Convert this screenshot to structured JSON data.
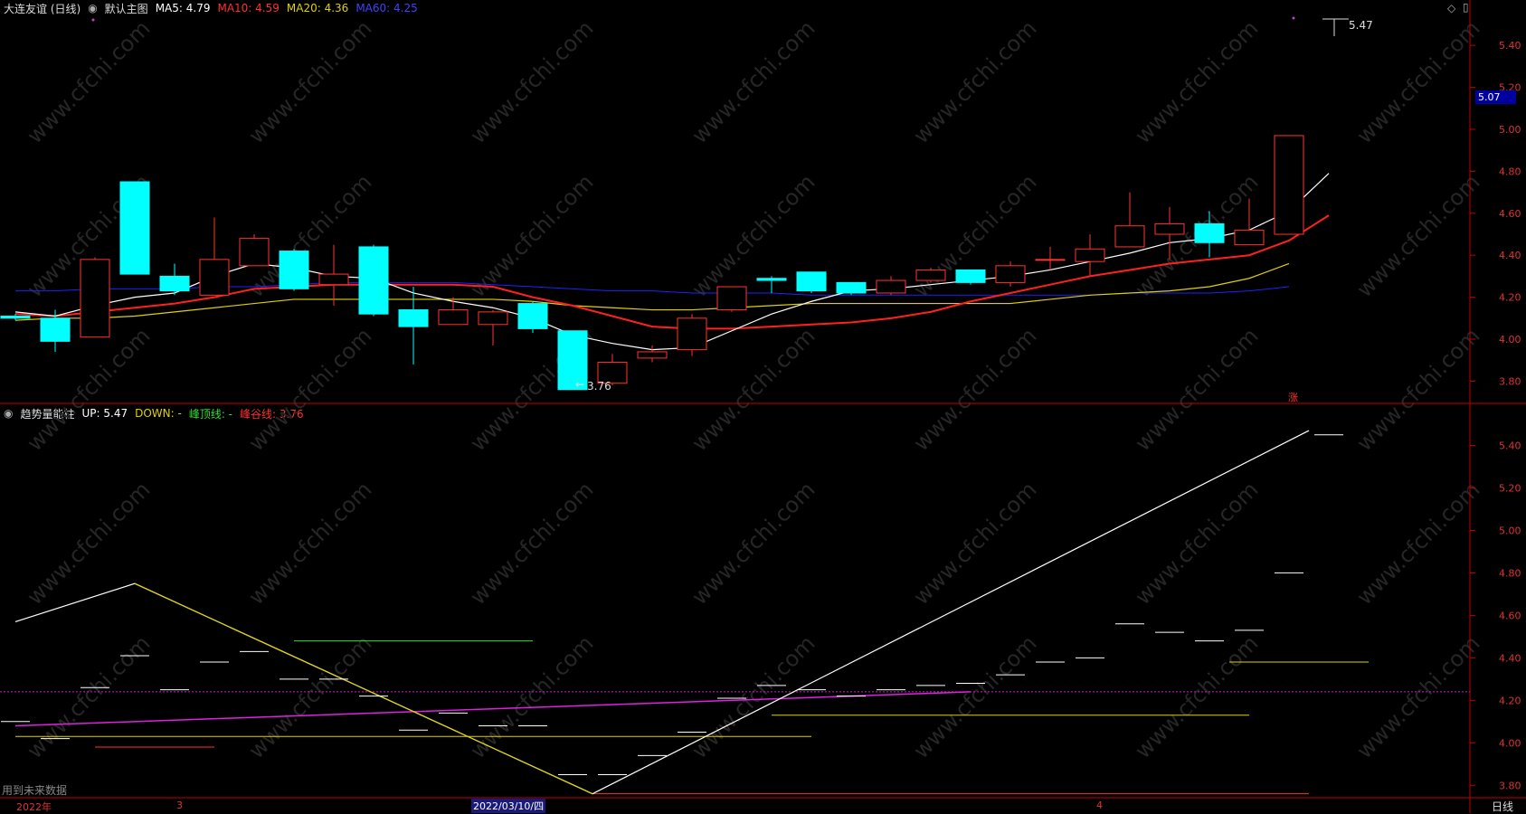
{
  "top_legend": {
    "stock_name": "大连友谊 (日线)",
    "main_chart": "默认主图",
    "ma5": "MA5: 4.79",
    "ma10": "MA10: 4.59",
    "ma20": "MA20: 4.36",
    "ma60": "MA60: 4.25"
  },
  "bottom_legend": {
    "indicator": "趋势量能柱",
    "up": "UP: 5.47",
    "down": "DOWN: -",
    "peak": "峰顶线: -",
    "valley": "峰谷线: 3.76"
  },
  "colors": {
    "up_candle": "#ff3232",
    "down_candle": "#00ffff",
    "ma5": "#ffffff",
    "ma10": "#ff2020",
    "ma20": "#e0d000",
    "ma60": "#2020ff",
    "axis": "#c00000"
  },
  "price_axis": [
    "5.40",
    "5.20",
    "5.00",
    "4.80",
    "4.60",
    "4.40",
    "4.20",
    "4.00",
    "3.80"
  ],
  "indicator_axis": [
    "5.40",
    "5.20",
    "5.00",
    "4.80",
    "4.60",
    "4.40",
    "4.20",
    "4.00",
    "3.80"
  ],
  "current_price_tag": "5.07",
  "high_marker": "5.47",
  "low_marker": "3.76",
  "rise_badge": "涨",
  "future_data_note": "用到未来数据",
  "x_labels": {
    "year": "2022年",
    "m3": "3",
    "cursor_date": "2022/03/10/四",
    "m4": "4"
  },
  "period_button": "日线",
  "watermark": "www.cfchi.com",
  "chart_data": {
    "type": "candlestick",
    "candles": [
      {
        "o": 4.11,
        "h": 4.12,
        "l": 4.09,
        "c": 4.1
      },
      {
        "o": 4.1,
        "h": 4.14,
        "l": 3.94,
        "c": 3.99
      },
      {
        "o": 4.01,
        "h": 4.39,
        "l": 4.01,
        "c": 4.38
      },
      {
        "o": 4.75,
        "h": 4.75,
        "l": 4.31,
        "c": 4.31
      },
      {
        "o": 4.3,
        "h": 4.36,
        "l": 4.21,
        "c": 4.23
      },
      {
        "o": 4.21,
        "h": 4.58,
        "l": 4.21,
        "c": 4.38
      },
      {
        "o": 4.35,
        "h": 4.5,
        "l": 4.35,
        "c": 4.48
      },
      {
        "o": 4.42,
        "h": 4.43,
        "l": 4.23,
        "c": 4.24
      },
      {
        "o": 4.26,
        "h": 4.45,
        "l": 4.16,
        "c": 4.31
      },
      {
        "o": 4.44,
        "h": 4.45,
        "l": 4.11,
        "c": 4.12
      },
      {
        "o": 4.14,
        "h": 4.25,
        "l": 3.88,
        "c": 4.06
      },
      {
        "o": 4.07,
        "h": 4.2,
        "l": 4.07,
        "c": 4.14
      },
      {
        "o": 4.07,
        "h": 4.14,
        "l": 3.97,
        "c": 4.13
      },
      {
        "o": 4.17,
        "h": 4.18,
        "l": 4.03,
        "c": 4.05
      },
      {
        "o": 4.04,
        "h": 4.04,
        "l": 3.76,
        "c": 3.76
      },
      {
        "o": 3.79,
        "h": 3.93,
        "l": 3.78,
        "c": 3.89
      },
      {
        "o": 3.91,
        "h": 3.97,
        "l": 3.89,
        "c": 3.94
      },
      {
        "o": 3.95,
        "h": 4.12,
        "l": 3.92,
        "c": 4.1
      },
      {
        "o": 4.14,
        "h": 4.25,
        "l": 4.13,
        "c": 4.25
      },
      {
        "o": 4.29,
        "h": 4.3,
        "l": 4.22,
        "c": 4.28
      },
      {
        "o": 4.32,
        "h": 4.32,
        "l": 4.22,
        "c": 4.23
      },
      {
        "o": 4.27,
        "h": 4.27,
        "l": 4.21,
        "c": 4.22
      },
      {
        "o": 4.22,
        "h": 4.3,
        "l": 4.21,
        "c": 4.28
      },
      {
        "o": 4.28,
        "h": 4.34,
        "l": 4.27,
        "c": 4.33
      },
      {
        "o": 4.33,
        "h": 4.33,
        "l": 4.26,
        "c": 4.27
      },
      {
        "o": 4.27,
        "h": 4.37,
        "l": 4.25,
        "c": 4.35
      },
      {
        "o": 4.38,
        "h": 4.44,
        "l": 4.33,
        "c": 4.38
      },
      {
        "o": 4.37,
        "h": 4.5,
        "l": 4.3,
        "c": 4.43
      },
      {
        "o": 4.44,
        "h": 4.7,
        "l": 4.44,
        "c": 4.54
      },
      {
        "o": 4.5,
        "h": 4.63,
        "l": 4.38,
        "c": 4.55
      },
      {
        "o": 4.55,
        "h": 4.61,
        "l": 4.39,
        "c": 4.46
      },
      {
        "o": 4.45,
        "h": 4.67,
        "l": 4.45,
        "c": 4.52
      },
      {
        "o": 4.5,
        "h": 4.97,
        "l": 4.5,
        "c": 4.97
      }
    ],
    "ma5": [
      4.13,
      4.11,
      4.16,
      4.2,
      4.22,
      4.3,
      4.36,
      4.34,
      4.3,
      4.29,
      4.22,
      4.18,
      4.15,
      4.1,
      4.02,
      3.98,
      3.95,
      3.96,
      4.04,
      4.12,
      4.18,
      4.23,
      4.24,
      4.26,
      4.28,
      4.3,
      4.33,
      4.37,
      4.41,
      4.46,
      4.48,
      4.52,
      4.61,
      4.79
    ],
    "ma10": [
      4.12,
      4.11,
      4.13,
      4.15,
      4.17,
      4.2,
      4.24,
      4.25,
      4.26,
      4.26,
      4.26,
      4.26,
      4.25,
      4.2,
      4.16,
      4.11,
      4.06,
      4.05,
      4.05,
      4.06,
      4.07,
      4.08,
      4.1,
      4.13,
      4.18,
      4.22,
      4.26,
      4.3,
      4.33,
      4.36,
      4.38,
      4.4,
      4.47,
      4.59
    ],
    "ma20": [
      4.09,
      4.1,
      4.1,
      4.11,
      4.13,
      4.15,
      4.17,
      4.19,
      4.19,
      4.19,
      4.19,
      4.19,
      4.19,
      4.18,
      4.16,
      4.15,
      4.14,
      4.14,
      4.15,
      4.16,
      4.17,
      4.17,
      4.17,
      4.17,
      4.17,
      4.17,
      4.19,
      4.21,
      4.22,
      4.23,
      4.25,
      4.29,
      4.36
    ],
    "ma60": [
      4.23,
      4.23,
      4.24,
      4.24,
      4.24,
      4.25,
      4.25,
      4.26,
      4.27,
      4.27,
      4.27,
      4.27,
      4.26,
      4.25,
      4.24,
      4.23,
      4.23,
      4.22,
      4.22,
      4.22,
      4.21,
      4.21,
      4.21,
      4.21,
      4.21,
      4.21,
      4.21,
      4.21,
      4.22,
      4.22,
      4.22,
      4.23,
      4.25
    ],
    "ylim": [
      3.72,
      5.53
    ],
    "indicator": {
      "ylim": [
        3.75,
        5.53
      ],
      "up_line": [
        {
          "i": 0,
          "v": 4.57
        },
        {
          "i": 3,
          "v": 4.75
        },
        {
          "i": 14.5,
          "v": 3.76
        },
        {
          "i": 32.5,
          "v": 5.47
        }
      ],
      "valley_line": [
        {
          "i": 3,
          "v": 4.75
        },
        {
          "i": 14.5,
          "v": 3.76
        }
      ],
      "dashes": [
        4.1,
        4.02,
        4.26,
        4.41,
        4.25,
        4.38,
        4.43,
        4.3,
        4.3,
        4.22,
        4.06,
        4.14,
        4.08,
        4.08,
        3.85,
        3.85,
        3.94,
        4.05,
        4.21,
        4.27,
        4.25,
        4.22,
        4.25,
        4.27,
        4.28,
        4.32,
        4.38,
        4.4,
        4.56,
        4.52,
        4.48,
        4.53,
        4.8,
        5.45
      ],
      "h_green": {
        "from": 7,
        "to": 13,
        "v": 4.48
      },
      "h_red": {
        "from": 2,
        "to": 5,
        "v": 3.98
      },
      "h_yellow1": {
        "from": 0,
        "to": 20,
        "v": 4.03
      },
      "h_yellow2": {
        "from": 19,
        "to": 31,
        "v": 4.13
      },
      "h_yellow3": {
        "from": 30.5,
        "to": 34,
        "v": 4.38
      },
      "magenta_dotted": 4.24,
      "magenta_line": [
        {
          "i": 0,
          "v": 4.08
        },
        {
          "i": 24,
          "v": 4.24
        }
      ]
    }
  }
}
